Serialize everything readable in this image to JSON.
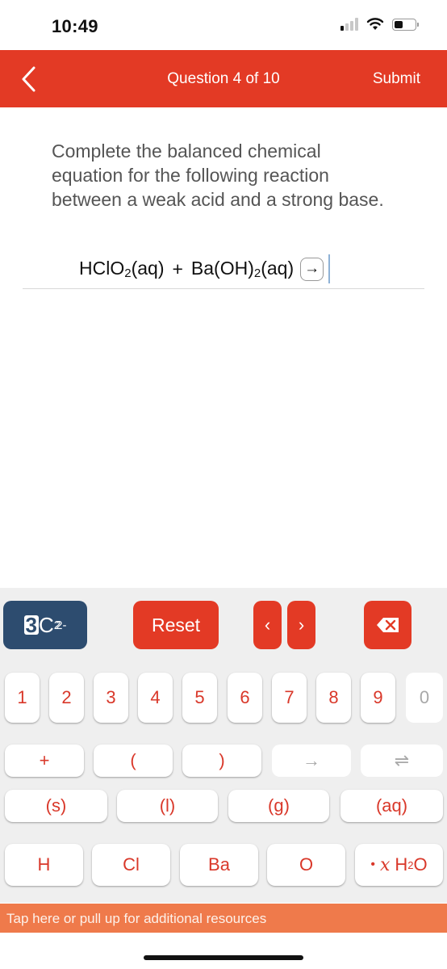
{
  "status_bar": {
    "time": "10:49",
    "signal_bars_on": 1,
    "signal_bars_total": 4,
    "battery_level": 0.35
  },
  "nav": {
    "back_icon": "chevron-left-icon",
    "title": "Question 4 of 10",
    "submit_label": "Submit"
  },
  "question": {
    "prompt": "Complete the balanced chemical equation for the following reaction between a weak acid and a strong base.",
    "equation": {
      "reactant1_main": "HClO",
      "reactant1_sub": "2",
      "reactant1_state": "(aq)",
      "plus": "+",
      "reactant2_main": "Ba(OH)",
      "reactant2_sub": "2",
      "reactant2_state": "(aq)",
      "arrow": "→"
    }
  },
  "toolbar": {
    "formula_coef": "3",
    "formula_elem": "C",
    "formula_sub": "2",
    "formula_sup": "2-",
    "reset_label": "Reset",
    "prev_label": "‹",
    "next_label": "›",
    "delete_icon": "backspace-icon"
  },
  "keypad": {
    "digits": [
      "1",
      "2",
      "3",
      "4",
      "5",
      "6",
      "7",
      "8",
      "9",
      "0"
    ],
    "operators": [
      "+",
      "(",
      ")",
      "→",
      "⇌"
    ],
    "states": [
      "(s)",
      "(l)",
      "(g)",
      "(aq)"
    ],
    "elements": [
      "H",
      "Cl",
      "Ba",
      "O"
    ],
    "hydrate": {
      "dot": "•",
      "x": "x",
      "main": "H",
      "sub": "2",
      "tail": "O"
    }
  },
  "resources_bar": {
    "label": "Tap here or pull up for additional resources"
  },
  "colors": {
    "brand_red": "#e33a25",
    "formula_blue": "#2d4c6f",
    "resources_orange": "#ef7a4b",
    "key_text": "#d9382a",
    "disabled_text": "#a8a8a8"
  }
}
